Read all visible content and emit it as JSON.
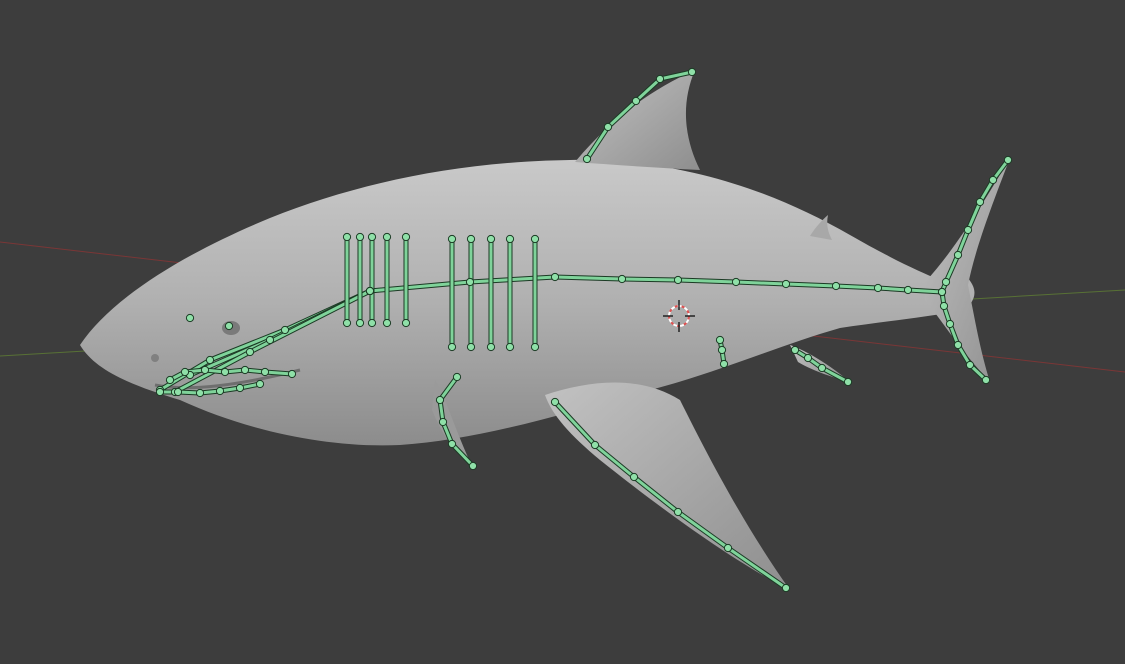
{
  "viewport": {
    "mode": "pose-view",
    "background": "#3d3d3d",
    "mesh_color": "#b5b5b5",
    "bone_color": "#7fd39a",
    "axis_x_color": "#a33a3a",
    "axis_y_color": "#6a8a3a",
    "cursor_color": "#e05050"
  },
  "scene": {
    "object": "shark-mesh",
    "armature": "shark-armature",
    "icons": [
      "3d-cursor-icon"
    ]
  }
}
